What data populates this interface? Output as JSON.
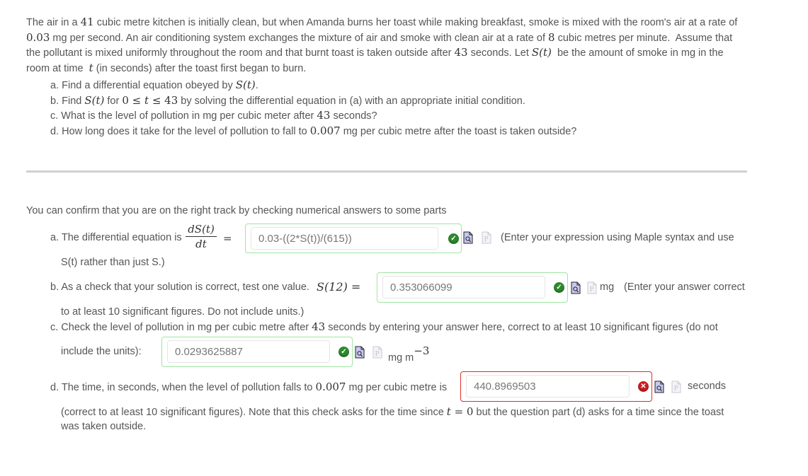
{
  "problem": {
    "intro_lines": [
      [
        {
          "t": "The air in a "
        },
        {
          "m": "41"
        },
        {
          "t": " cubic metre kitchen is initially clean, but when Amanda burns her toast while making breakfast, smoke is mixed with the room's air at a rate of"
        }
      ],
      [
        {
          "m": "0.03"
        },
        {
          "t": " mg per second. An air conditioning system exchanges the mixture of air and smoke with clean air at a rate of "
        },
        {
          "m": "8"
        },
        {
          "t": " cubic metres per minute.  Assume that"
        }
      ],
      [
        {
          "t": "the pollutant is mixed uniformly throughout the room and that burnt toast is taken outside after "
        },
        {
          "m": "43"
        },
        {
          "t": " seconds. Let "
        },
        {
          "mi": "S(t)"
        },
        {
          "t": "  be the amount of smoke in mg in the"
        }
      ],
      [
        {
          "t": "room at time  "
        },
        {
          "mi": "t"
        },
        {
          "t": " (in seconds) after the toast first began to burn."
        }
      ]
    ],
    "parts": [
      [
        {
          "t": "a. Find a differential equation obeyed by "
        },
        {
          "mi": "S(t)"
        },
        {
          "t": "."
        }
      ],
      [
        {
          "t": "b. Find "
        },
        {
          "mi": "S(t)"
        },
        {
          "t": " for "
        },
        {
          "m": "0 ≤ "
        },
        {
          "mi": "t"
        },
        {
          "m": " ≤ 43"
        },
        {
          "t": " by solving the differential equation in (a) with an appropriate initial condition."
        }
      ],
      [
        {
          "t": "c. What is the level of pollution in mg per cubic meter after "
        },
        {
          "m": "43"
        },
        {
          "t": " seconds?"
        }
      ],
      [
        {
          "t": "d. How long does it take for the level of pollution to fall to "
        },
        {
          "m": "0.007"
        },
        {
          "t": " mg per cubic metre after the toast is taken outside?"
        }
      ]
    ]
  },
  "check": {
    "intro": "You can confirm that you are on the right track by checking numerical answers to some parts",
    "a": {
      "label": "a. The differential equation is",
      "frac_num": "dS(t)",
      "frac_den": "dt",
      "equals": "=",
      "value": "0.03-((2*S(t))/(615))",
      "status": "correct",
      "hint_line1": "(Enter your expression using Maple syntax and use",
      "hint_line2": "S(t) rather than just S.)"
    },
    "b": {
      "label": "b. As a check that your solution is correct, test one value.",
      "math": "S(12) =",
      "value": "0.353066099",
      "status": "correct",
      "unit": "mg",
      "hint_line1": "(Enter your answer correct",
      "hint_line2": "to at least 10 significant figures. Do not include units.)"
    },
    "c": {
      "label_pre": "c. Check the level of pollution in mg per cubic metre after ",
      "label_num": "43",
      "label_post": " seconds by entering your answer here, correct to at least 10 significant figures (do not",
      "label_line2": "include the units):",
      "value": "0.0293625887",
      "status": "correct",
      "unit": "mg m",
      "unit_exp": "−3"
    },
    "d": {
      "label_pre": "d. The time, in seconds, when the level of pollution falls to ",
      "label_num": "0.007",
      "label_post": " mg per cubic metre is",
      "value": "440.8969503",
      "status": "incorrect",
      "unit": "seconds",
      "note_pre": "(correct to at least 10 significant figures).  Note that this check asks for the time since ",
      "note_t": "t",
      "note_eq": " = 0",
      "note_post": " but the question part (d) asks for a time since the toast",
      "note_line2": "was taken outside."
    }
  },
  "colors": {
    "correct_border": "#9ee69e",
    "incorrect_border": "#e32b2b",
    "correct_icon": "#2c8a2c",
    "incorrect_icon": "#cc1e1e"
  }
}
